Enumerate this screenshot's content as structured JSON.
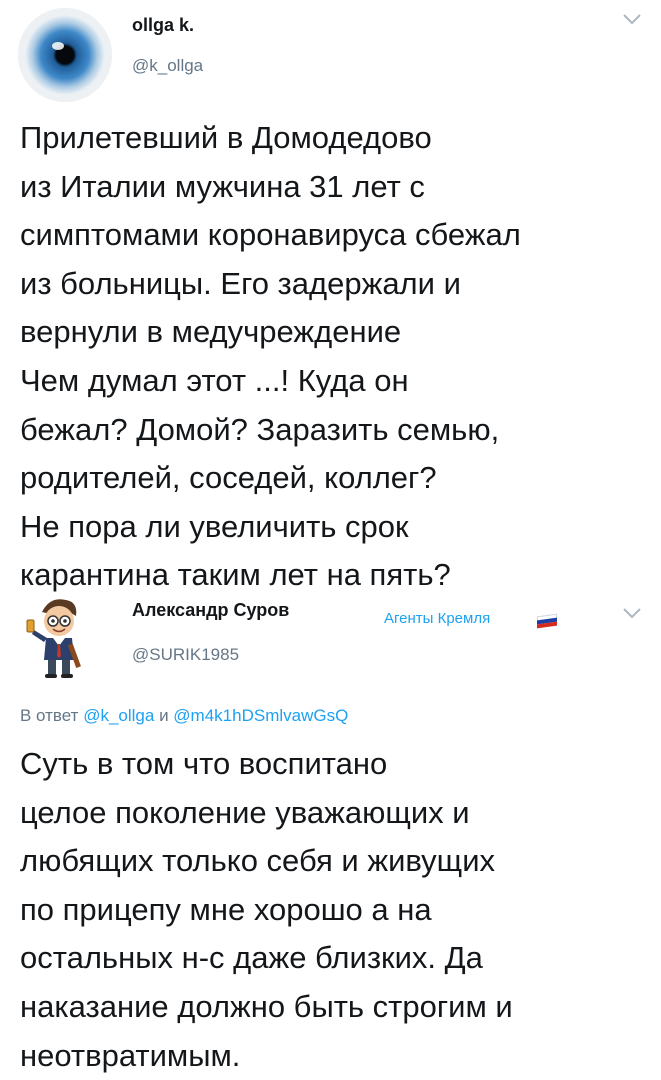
{
  "tweet1": {
    "author_name": "ollga k.",
    "author_handle": "@k_ollga",
    "text_lines": [
      "Прилетевший в Домодедово",
      "из Италии мужчина 31 лет с",
      "симптомами коронавируса сбежал",
      "из больницы. Его задержали и",
      "вернули в медучреждение",
      "Чем думал этот ...! Куда он",
      "бежал? Домой? Заразить семью,",
      "родителей, соседей, коллег?",
      "Не пора ли увеличить срок",
      "карантина таким лет на пять?"
    ],
    "avatar_icon": "eye-avatar-icon",
    "menu_icon": "chevron-down-icon"
  },
  "tweet2": {
    "author_name": "Александр Суров",
    "badge": "Агенты Кремля",
    "badge_icon": "russian-flag-icon",
    "author_handle": "@SURIK1985",
    "reply_prefix": "В ответ",
    "reply_mention_1": "@k_ollga",
    "reply_conj": "и",
    "reply_mention_2": "@m4k1hDSmlvawGsQ",
    "text_lines": [
      "Суть в том что воспитано",
      "целое поколение уважающих и",
      "любящих только себя и живущих",
      "по прицепу мне хорошо а на",
      "остальных н-с даже близких. Да",
      "наказание должно быть строгим и",
      "неотвратимым."
    ],
    "avatar_icon": "cartoon-character-avatar-icon",
    "menu_icon": "chevron-down-icon"
  },
  "colors": {
    "text": "#14171a",
    "secondary": "#657786",
    "accent": "#1da1f2",
    "chevron": "#aab8c2"
  }
}
